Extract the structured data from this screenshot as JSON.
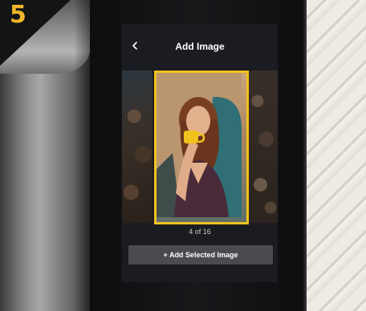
{
  "step": {
    "number": "5"
  },
  "header": {
    "title": "Add Image",
    "back_icon": "chevron-left-icon"
  },
  "carousel": {
    "counter": "4 of 16"
  },
  "actions": {
    "add_label": "+ Add Selected Image"
  },
  "colors": {
    "accent": "#f0c21e",
    "badge": "#f2b62b",
    "screen_bg": "#1b1c21",
    "button_bg": "#4a4b51"
  }
}
